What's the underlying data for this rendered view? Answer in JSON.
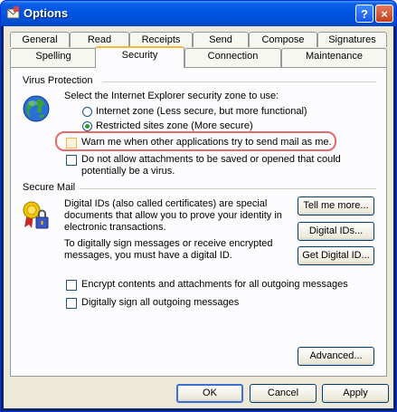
{
  "window": {
    "title": "Options",
    "help_label": "?",
    "close_label": "×"
  },
  "tabs_row1": [
    "General",
    "Read",
    "Receipts",
    "Send",
    "Compose",
    "Signatures"
  ],
  "tabs_row2": [
    "Spelling",
    "Security",
    "Connection",
    "Maintenance"
  ],
  "virus": {
    "group_label": "Virus Protection",
    "zone_prompt": "Select the Internet Explorer security zone to use:",
    "radio_internet": "Internet zone (Less secure, but more functional)",
    "radio_restricted": "Restricted sites zone (More secure)",
    "warn_label": "Warn me when other applications try to send mail as me.",
    "attach_label_1": "Do not allow attachments to be saved or opened that could",
    "attach_label_2": "potentially be a virus."
  },
  "secure": {
    "group_label": "Secure Mail",
    "desc1_l1": "Digital IDs (also called certificates) are special",
    "desc1_l2": "documents that allow you to prove your identity in",
    "desc1_l3": "electronic transactions.",
    "desc2_l1": "To digitally sign messages or receive encrypted",
    "desc2_l2": "messages, you must have a digital ID.",
    "tell_more": "Tell me more...",
    "digital_ids": "Digital IDs...",
    "get_id": "Get Digital ID...",
    "encrypt_label": "Encrypt contents and attachments for all outgoing messages",
    "sign_label": "Digitally sign all outgoing messages"
  },
  "advanced_label": "Advanced...",
  "footer": {
    "ok": "OK",
    "cancel": "Cancel",
    "apply": "Apply"
  }
}
